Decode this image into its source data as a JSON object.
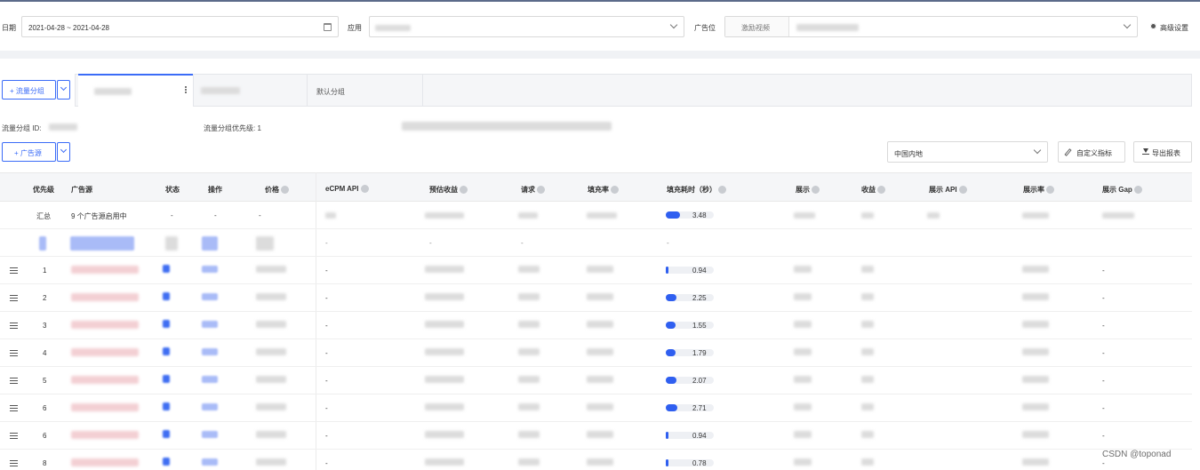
{
  "filters": {
    "date_label": "日期",
    "date_value": "2021-04-28 ~ 2021-04-28",
    "app_label": "应用",
    "app_value": "",
    "placement_label": "广告位",
    "placement_segment": "激励视频",
    "advanced_settings": "高级设置"
  },
  "tabs": {
    "add_group_button": "+ 流量分组",
    "default_group": "默认分组"
  },
  "group_info": {
    "group_id_label": "流量分组 ID:",
    "priority_label": "流量分组优先级: 1"
  },
  "toolbar": {
    "add_source_button": "+ 广告源",
    "region_select": "中国内地",
    "custom_metrics_button": "自定义指标",
    "export_button": "导出报表"
  },
  "table": {
    "headers": [
      "优先级",
      "广告源",
      "状态",
      "操作",
      "价格",
      "eCPM API",
      "预估收益",
      "请求",
      "填充率",
      "填充耗时（秒）",
      "展示",
      "收益",
      "展示 API",
      "展示率",
      "展示 Gap"
    ],
    "summary": {
      "label": "汇总",
      "sources": "9 个广告源启用中",
      "status": "-",
      "action": "-",
      "price": "-",
      "fill_time": "3.48",
      "fill_time_fraction": 0.3
    },
    "blank_row": [
      "-",
      "-",
      "-",
      "-"
    ],
    "rows": [
      {
        "priority": "1",
        "ecpm_api": "-",
        "fill_time": "0.94",
        "fraction": 0.06,
        "gap": "-"
      },
      {
        "priority": "2",
        "ecpm_api": "-",
        "fill_time": "2.25",
        "fraction": 0.22,
        "gap": "-"
      },
      {
        "priority": "3",
        "ecpm_api": "-",
        "fill_time": "1.55",
        "fraction": 0.2,
        "gap": "-"
      },
      {
        "priority": "4",
        "ecpm_api": "-",
        "fill_time": "1.79",
        "fraction": 0.2,
        "gap": "-"
      },
      {
        "priority": "5",
        "ecpm_api": "-",
        "fill_time": "2.07",
        "fraction": 0.22,
        "gap": "-"
      },
      {
        "priority": "6",
        "ecpm_api": "-",
        "fill_time": "2.71",
        "fraction": 0.24,
        "gap": "-"
      },
      {
        "priority": "6",
        "ecpm_api": "-",
        "fill_time": "0.94",
        "fraction": 0.06,
        "gap": "-"
      },
      {
        "priority": "8",
        "ecpm_api": "-",
        "fill_time": "0.78",
        "fraction": 0.05,
        "gap": "-"
      }
    ]
  },
  "watermark": "CSDN @toponad",
  "colors": {
    "accent": "#3b6cf7",
    "bar": "#2f5ff0"
  }
}
